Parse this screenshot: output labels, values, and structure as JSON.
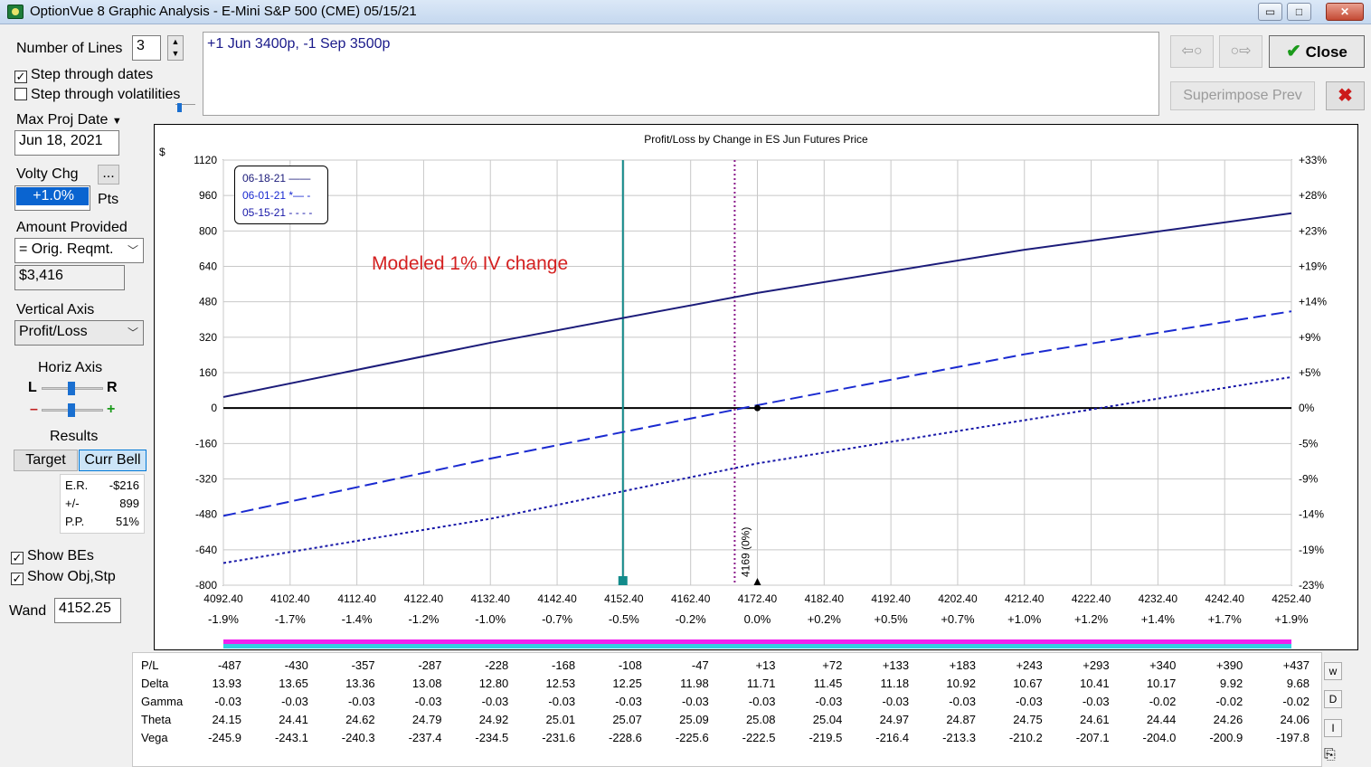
{
  "window": {
    "title": "OptionVue 8 Graphic Analysis - E-Mini S&P 500 (CME)  05/15/21",
    "minimize": "▭",
    "maximize": "□",
    "close": "✕"
  },
  "controls": {
    "number_of_lines_label": "Number of Lines",
    "number_of_lines": "3",
    "step_dates_label": "Step through dates",
    "step_dates_checked": "✓",
    "step_vols_label": "Step through volatilities",
    "max_proj_date_label": "Max Proj Date",
    "max_proj_date": "Jun 18, 2021",
    "volty_chg_label": "Volty Chg",
    "volty_chg_more": "...",
    "volty_chg": "+1.0%",
    "volty_unit": "Pts",
    "amount_provided_label": "Amount Provided",
    "amount_provided_select": "= Orig. Reqmt.",
    "amount_value": "$3,416",
    "vertical_axis_label": "Vertical Axis",
    "vertical_axis_select": "Profit/Loss",
    "horiz_axis_label": "Horiz Axis",
    "horiz_left": "L",
    "horiz_right": "R",
    "minus": "–",
    "plus": "+",
    "results_label": "Results",
    "target_btn": "Target",
    "curr_bell_btn": "Curr Bell",
    "er_label": "E.R.",
    "er_value": "-$216",
    "pm_label": "+/-",
    "pm_value": "899",
    "pp_label": "P.P.",
    "pp_value": "51%",
    "show_bes_label": "Show BEs",
    "show_obj_label": "Show Obj,Stp",
    "check": "✓",
    "wand_label": "Wand",
    "wand_value": "4152.25"
  },
  "position_text": "+1 Jun 3400p, -1 Sep 3500p",
  "buttons": {
    "prev": "⇦○",
    "next": "○⇨",
    "close": "Close",
    "close_check": "✔",
    "superimpose": "Superimpose Prev",
    "cancel": "✖"
  },
  "colors": {
    "line_solid": "#1c1c7a",
    "line_dash": "#1a2ad0",
    "line_dot": "#1818a8",
    "wand_line": "#138b8b",
    "center_line": "#8a1a8a",
    "annotation": "#d42020"
  },
  "chart_data": {
    "type": "line",
    "title": "Profit/Loss by Change in ES Jun Futures Price",
    "ylabel": "$",
    "annotation": "Modeled 1% IV change",
    "center_label": "4169 (0%)",
    "center_x": 4169,
    "wand_x": 4152.25,
    "ylim": [
      -800,
      1120
    ],
    "xlim": [
      4092.4,
      4252.4
    ],
    "y_ticks": [
      "1120",
      "960",
      "800",
      "640",
      "480",
      "320",
      "160",
      "0",
      "-160",
      "-320",
      "-480",
      "-640",
      "-800"
    ],
    "right_ticks": [
      "+33%",
      "+28%",
      "+23%",
      "+19%",
      "+14%",
      "+9%",
      "+5%",
      "0%",
      "-5%",
      "-9%",
      "-14%",
      "-19%",
      "-23%"
    ],
    "x_ticks": [
      "4092.40",
      "4102.40",
      "4112.40",
      "4122.40",
      "4132.40",
      "4142.40",
      "4152.40",
      "4162.40",
      "4172.40",
      "4182.40",
      "4192.40",
      "4202.40",
      "4212.40",
      "4222.40",
      "4232.40",
      "4242.40",
      "4252.40"
    ],
    "x_pct": [
      "-1.9%",
      "-1.7%",
      "-1.4%",
      "-1.2%",
      "-1.0%",
      "-0.7%",
      "-0.5%",
      "-0.2%",
      "0.0%",
      "+0.2%",
      "+0.5%",
      "+0.7%",
      "+1.0%",
      "+1.2%",
      "+1.4%",
      "+1.7%",
      "+1.9%"
    ],
    "series": [
      {
        "name": "06-18-21",
        "style": "solid",
        "legend": "06-18-21 ——",
        "x": [
          4092.4,
          4132.4,
          4172.4,
          4212.4,
          4252.4
        ],
        "y": [
          50,
          295,
          520,
          715,
          880
        ]
      },
      {
        "name": "06-01-21",
        "style": "dash",
        "legend": "06-01-21 *— -",
        "x": [
          4092.4,
          4132.4,
          4172.4,
          4212.4,
          4252.4
        ],
        "y": [
          -487,
          -228,
          13,
          243,
          437
        ]
      },
      {
        "name": "05-15-21",
        "style": "dot",
        "legend": "05-15-21 - - - -",
        "x": [
          4092.4,
          4132.4,
          4172.4,
          4212.4,
          4252.4
        ],
        "y": [
          -700,
          -500,
          -250,
          -55,
          140
        ]
      }
    ]
  },
  "table": {
    "rows": [
      {
        "label": "P/L",
        "values": [
          "-487",
          "-430",
          "-357",
          "-287",
          "-228",
          "-168",
          "-108",
          "-47",
          "+13",
          "+72",
          "+133",
          "+183",
          "+243",
          "+293",
          "+340",
          "+390",
          "+437"
        ]
      },
      {
        "label": "Delta",
        "values": [
          "13.93",
          "13.65",
          "13.36",
          "13.08",
          "12.80",
          "12.53",
          "12.25",
          "11.98",
          "11.71",
          "11.45",
          "11.18",
          "10.92",
          "10.67",
          "10.41",
          "10.17",
          "9.92",
          "9.68"
        ]
      },
      {
        "label": "Gamma",
        "values": [
          "-0.03",
          "-0.03",
          "-0.03",
          "-0.03",
          "-0.03",
          "-0.03",
          "-0.03",
          "-0.03",
          "-0.03",
          "-0.03",
          "-0.03",
          "-0.03",
          "-0.03",
          "-0.03",
          "-0.02",
          "-0.02",
          "-0.02"
        ]
      },
      {
        "label": "Theta",
        "values": [
          "24.15",
          "24.41",
          "24.62",
          "24.79",
          "24.92",
          "25.01",
          "25.07",
          "25.09",
          "25.08",
          "25.04",
          "24.97",
          "24.87",
          "24.75",
          "24.61",
          "24.44",
          "24.26",
          "24.06"
        ]
      },
      {
        "label": "Vega",
        "values": [
          "-245.9",
          "-243.1",
          "-240.3",
          "-237.4",
          "-234.5",
          "-231.6",
          "-228.6",
          "-225.6",
          "-222.5",
          "-219.5",
          "-216.4",
          "-213.3",
          "-210.2",
          "-207.1",
          "-204.0",
          "-200.9",
          "-197.8"
        ]
      }
    ],
    "side": {
      "w": "w",
      "d": "D",
      "i": "I",
      "export": "⎘"
    }
  }
}
